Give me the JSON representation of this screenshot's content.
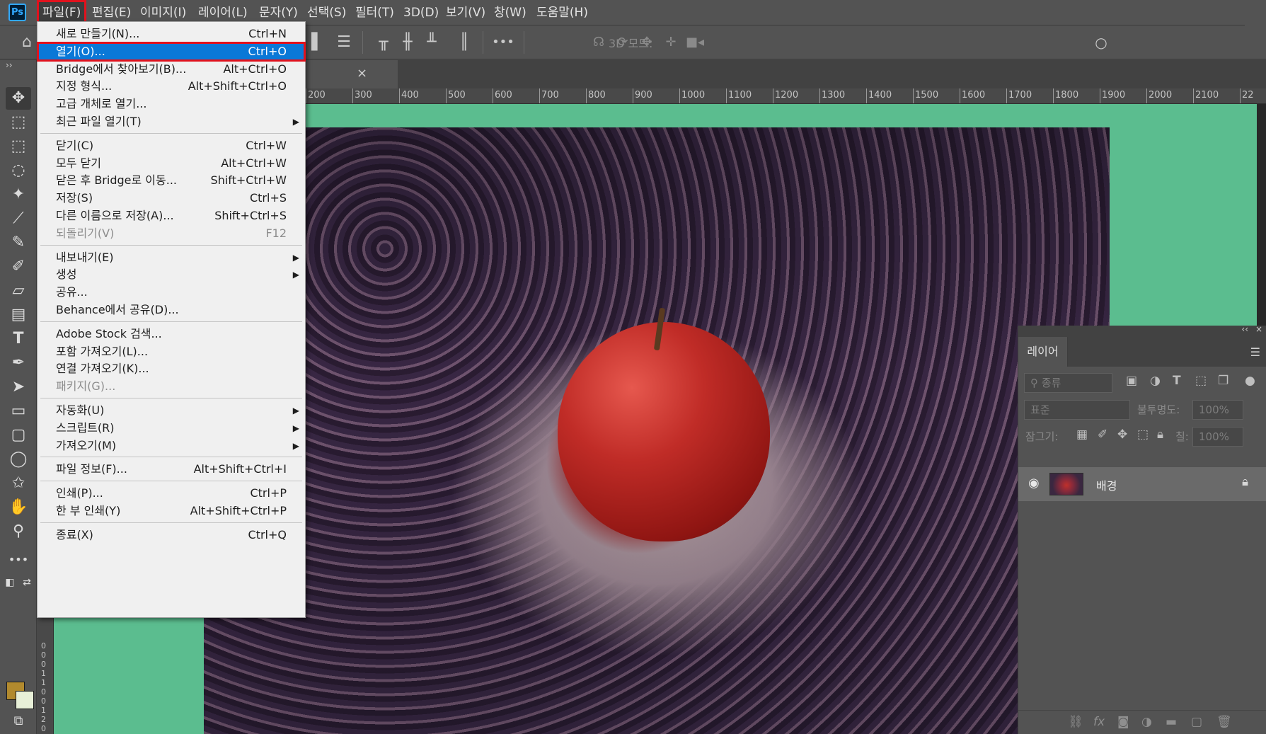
{
  "app": {
    "logo": "Ps"
  },
  "menubar": [
    {
      "label": "파일(F)",
      "active": true
    },
    {
      "label": "편집(E)"
    },
    {
      "label": "이미지(I)"
    },
    {
      "label": "레이어(L)"
    },
    {
      "label": "문자(Y)"
    },
    {
      "label": "선택(S)"
    },
    {
      "label": "필터(T)"
    },
    {
      "label": "3D(D)"
    },
    {
      "label": "보기(V)"
    },
    {
      "label": "창(W)"
    },
    {
      "label": "도움말(H)"
    }
  ],
  "options_bar": {
    "mode_3d_label": "3D 모드:",
    "more_label": "•••"
  },
  "document_tab": {
    "close": "×"
  },
  "ruler": {
    "top_labels": [
      "200",
      "300",
      "400",
      "500",
      "600",
      "700",
      "800",
      "900",
      "1000",
      "1100",
      "1200",
      "1300",
      "1400",
      "1500",
      "1600",
      "1700",
      "1800",
      "1900",
      "2000",
      "2100",
      "22"
    ],
    "left_labels": [
      "0",
      "0",
      "0",
      "1",
      "1",
      "0",
      "0",
      "1",
      "2",
      "0"
    ]
  },
  "file_menu": {
    "groups": [
      [
        {
          "label": "새로 만들기(N)...",
          "shortcut": "Ctrl+N"
        },
        {
          "label": "열기(O)...",
          "shortcut": "Ctrl+O",
          "highlighted": true
        },
        {
          "label": "Bridge에서 찾아보기(B)...",
          "shortcut": "Alt+Ctrl+O"
        },
        {
          "label": "지정 형식...",
          "shortcut": "Alt+Shift+Ctrl+O"
        },
        {
          "label": "고급 개체로 열기...",
          "shortcut": ""
        },
        {
          "label": "최근 파일 열기(T)",
          "shortcut": "",
          "submenu": true
        }
      ],
      [
        {
          "label": "닫기(C)",
          "shortcut": "Ctrl+W"
        },
        {
          "label": "모두 닫기",
          "shortcut": "Alt+Ctrl+W"
        },
        {
          "label": "닫은 후 Bridge로 이동...",
          "shortcut": "Shift+Ctrl+W"
        },
        {
          "label": "저장(S)",
          "shortcut": "Ctrl+S"
        },
        {
          "label": "다른 이름으로 저장(A)...",
          "shortcut": "Shift+Ctrl+S"
        },
        {
          "label": "되돌리기(V)",
          "shortcut": "F12",
          "disabled": true
        }
      ],
      [
        {
          "label": "내보내기(E)",
          "shortcut": "",
          "submenu": true
        },
        {
          "label": "생성",
          "shortcut": "",
          "submenu": true
        },
        {
          "label": "공유...",
          "shortcut": ""
        },
        {
          "label": "Behance에서 공유(D)...",
          "shortcut": ""
        }
      ],
      [
        {
          "label": "Adobe Stock 검색...",
          "shortcut": ""
        },
        {
          "label": "포함 가져오기(L)...",
          "shortcut": ""
        },
        {
          "label": "연결 가져오기(K)...",
          "shortcut": ""
        },
        {
          "label": "패키지(G)...",
          "shortcut": "",
          "disabled": true
        }
      ],
      [
        {
          "label": "자동화(U)",
          "shortcut": "",
          "submenu": true
        },
        {
          "label": "스크립트(R)",
          "shortcut": "",
          "submenu": true
        },
        {
          "label": "가져오기(M)",
          "shortcut": "",
          "submenu": true
        }
      ],
      [
        {
          "label": "파일 정보(F)...",
          "shortcut": "Alt+Shift+Ctrl+I"
        }
      ],
      [
        {
          "label": "인쇄(P)...",
          "shortcut": "Ctrl+P"
        },
        {
          "label": "한 부 인쇄(Y)",
          "shortcut": "Alt+Shift+Ctrl+P"
        }
      ],
      [
        {
          "label": "종료(X)",
          "shortcut": "Ctrl+Q"
        }
      ]
    ]
  },
  "layers_panel": {
    "tab_label": "레이어",
    "filter_placeholder": "종류",
    "blend_mode": "표준",
    "opacity_label": "불투명도:",
    "opacity_value": "100%",
    "lock_label": "잠그기:",
    "fill_label": "칠:",
    "fill_value": "100%",
    "collapse": "‹‹",
    "close": "×",
    "layers": [
      {
        "name": "배경",
        "visible": true,
        "locked": true
      }
    ],
    "fx_label": "fx"
  },
  "colors": {
    "foreground": "#b28a2e",
    "background": "#e8f0d8",
    "canvas_bg": "#5bbd8f",
    "highlight": "#0a78d7",
    "annotation_box": "#e1121d"
  }
}
